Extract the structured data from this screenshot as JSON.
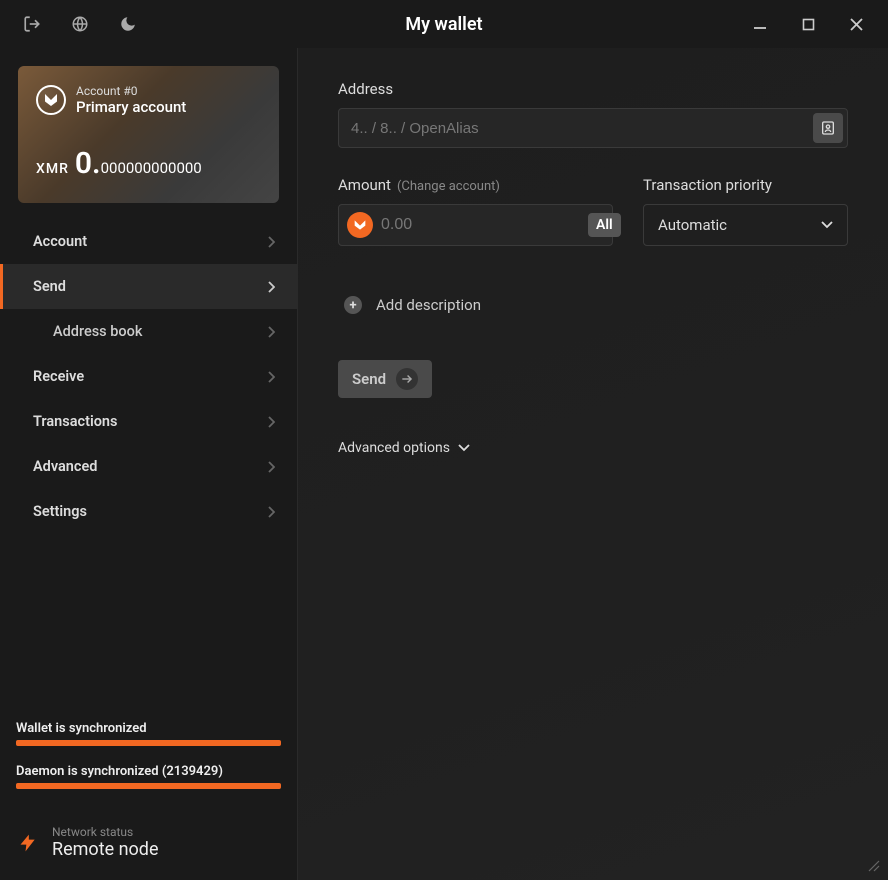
{
  "window": {
    "title": "My wallet"
  },
  "account_card": {
    "number": "Account #0",
    "name": "Primary account",
    "currency": "XMR",
    "balance_int": "0.",
    "balance_frac": "000000000000"
  },
  "nav": {
    "account": "Account",
    "send": "Send",
    "address_book": "Address book",
    "receive": "Receive",
    "transactions": "Transactions",
    "advanced": "Advanced",
    "settings": "Settings"
  },
  "sync": {
    "wallet_label": "Wallet is synchronized",
    "daemon_label": "Daemon is synchronized (2139429)"
  },
  "network": {
    "label": "Network status",
    "value": "Remote node"
  },
  "form": {
    "address_label": "Address",
    "address_placeholder": "4.. / 8.. / OpenAlias",
    "amount_label": "Amount",
    "amount_sublabel": "(Change account)",
    "amount_placeholder": "0.00",
    "all_button": "All",
    "priority_label": "Transaction priority",
    "priority_value": "Automatic",
    "add_description": "Add description",
    "send_button": "Send",
    "advanced_options": "Advanced options"
  }
}
